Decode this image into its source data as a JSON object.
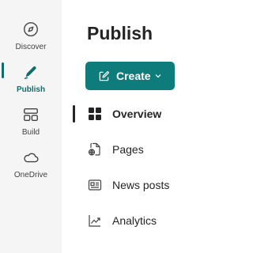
{
  "colors": {
    "accent": "#0f7c7c",
    "rail_bg": "#f5f5f5",
    "text": "#242424"
  },
  "rail": {
    "items": [
      {
        "label": "Discover",
        "icon": "compass-icon",
        "active": false
      },
      {
        "label": "Publish",
        "icon": "pen-icon",
        "active": true
      },
      {
        "label": "Build",
        "icon": "build-layout-icon",
        "active": false
      },
      {
        "label": "OneDrive",
        "icon": "cloud-icon",
        "active": false
      }
    ]
  },
  "main": {
    "title": "Publish",
    "create_button": {
      "label": "Create",
      "icon": "compose-icon",
      "chevron": "chevron-down-icon"
    },
    "nav": [
      {
        "label": "Overview",
        "icon": "grid-icon",
        "active": true
      },
      {
        "label": "Pages",
        "icon": "page-globe-icon",
        "active": false
      },
      {
        "label": "News posts",
        "icon": "news-icon",
        "active": false
      },
      {
        "label": "Analytics",
        "icon": "trend-chart-icon",
        "active": false
      }
    ]
  }
}
